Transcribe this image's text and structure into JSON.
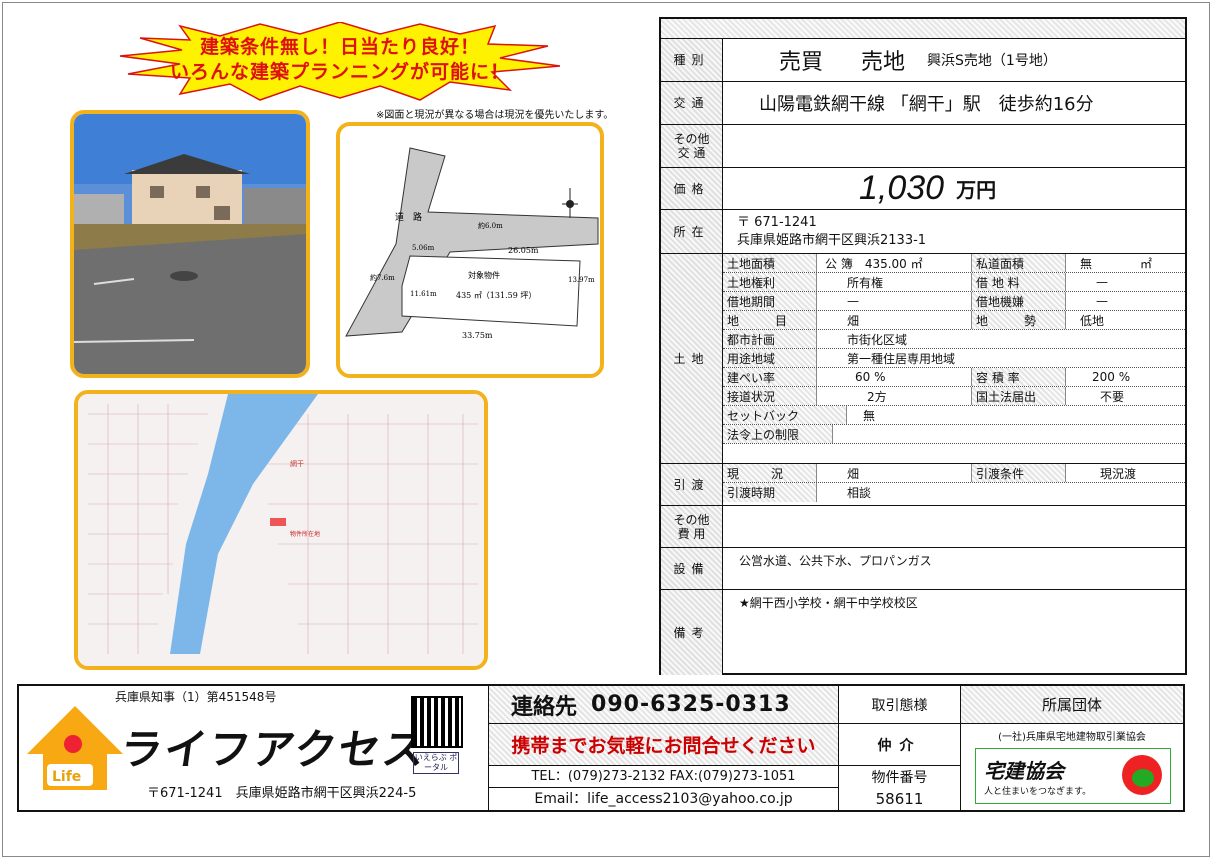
{
  "banner": {
    "line1": "建築条件無し！日当たり良好！",
    "line2": "いろんな建築プランニングが可能に！",
    "note": "※図面と現況が異なる場合は現況を優先いたします。"
  },
  "plan": {
    "road": "道　路",
    "target": "対象物件",
    "area": "435 ㎡（131.59 坪）",
    "frontage": "26.05m",
    "depth": "33.75m",
    "dim1": "5.06m",
    "dim2": "約6.0m",
    "dim3": "約7.6m",
    "dim4": "11.61m",
    "dim5": "13.97m"
  },
  "map": {
    "marker": "物件所在地",
    "station": "網干"
  },
  "spec": {
    "type_label": "種別",
    "deal_type": "売買",
    "property_type": "売地",
    "property_name": "興浜S売地（1号地）",
    "transport_label": "交通",
    "transport": "山陽電鉄網干線 「網干」駅　徒歩約16分",
    "other_transport_label": "その他\n交 通",
    "price_label": "価格",
    "price": "1,030",
    "price_unit": "万円",
    "address_label": "所在",
    "postal": "〒 671-1241",
    "address": "兵庫県姫路市網干区興浜2133-1",
    "land_label": "土地",
    "delivery_label": "引渡",
    "other_cost_label": "その他\n費 用",
    "facilities_label": "設備",
    "facilities": "公営水道、公共下水、プロパンガス",
    "remarks_label": "備考",
    "remarks": "★網干西小学校・網干中学校校区"
  },
  "land": {
    "l1a": "土地面積",
    "v1a": "公 簿　435.00 ㎡",
    "l1b": "私道面積",
    "v1b": "無　　　　㎡",
    "l2a": "土地権利",
    "v2a": "所有権",
    "l2b": "借 地 料",
    "v2b": "—",
    "l3a": "借地期間",
    "v3a": "—",
    "l3b": "借地機嫌",
    "v3b": "—",
    "l4a": "地　目",
    "v4a": "畑",
    "l4b": "地　勢",
    "v4b": "低地",
    "l5a": "都市計画",
    "v5a": "市街化区域",
    "l6a": "用途地域",
    "v6a": "第一種住居専用地域",
    "l7a": "建ぺい率",
    "v7a": "60 %",
    "l7b": "容 積 率",
    "v7b": "200 %",
    "l8a": "接道状況",
    "v8a": "2方",
    "l8b": "国土法届出",
    "v8b": "不要",
    "l9a": "セットバック",
    "v9a": "無",
    "l10a": "法令上の制限",
    "v10a": ""
  },
  "delivery": {
    "l1a": "現　況",
    "v1a": "畑",
    "l1b": "引渡条件",
    "v1b": "現況渡",
    "l2a": "引渡時期",
    "v2a": "相談"
  },
  "agency": {
    "license": "兵庫県知事（1）第451548号",
    "logo_mark": "Life",
    "name": "ライフアクセス",
    "address": "〒671-1241　兵庫県姫路市網干区興浜224-5",
    "portal": "いえらぶ ポータル",
    "contact_label": "連絡先",
    "contact_phone": "090-6325-0313",
    "inquiry": "携帯までお気軽にお問合せください",
    "telfax": "TEL：(079)273-2132 FAX:(079)273-1051",
    "email": "Email：life_access2103@yahoo.co.jp",
    "deal_label": "取引態様",
    "deal_value": "仲介",
    "number_label": "物件番号",
    "number_value": "58611",
    "assoc_label": "所属団体",
    "assoc_name": "(一社)兵庫県宅地建物取引業協会",
    "takken": "宅建協会",
    "takken_slogan": "人と住まいをつなぎます。"
  }
}
